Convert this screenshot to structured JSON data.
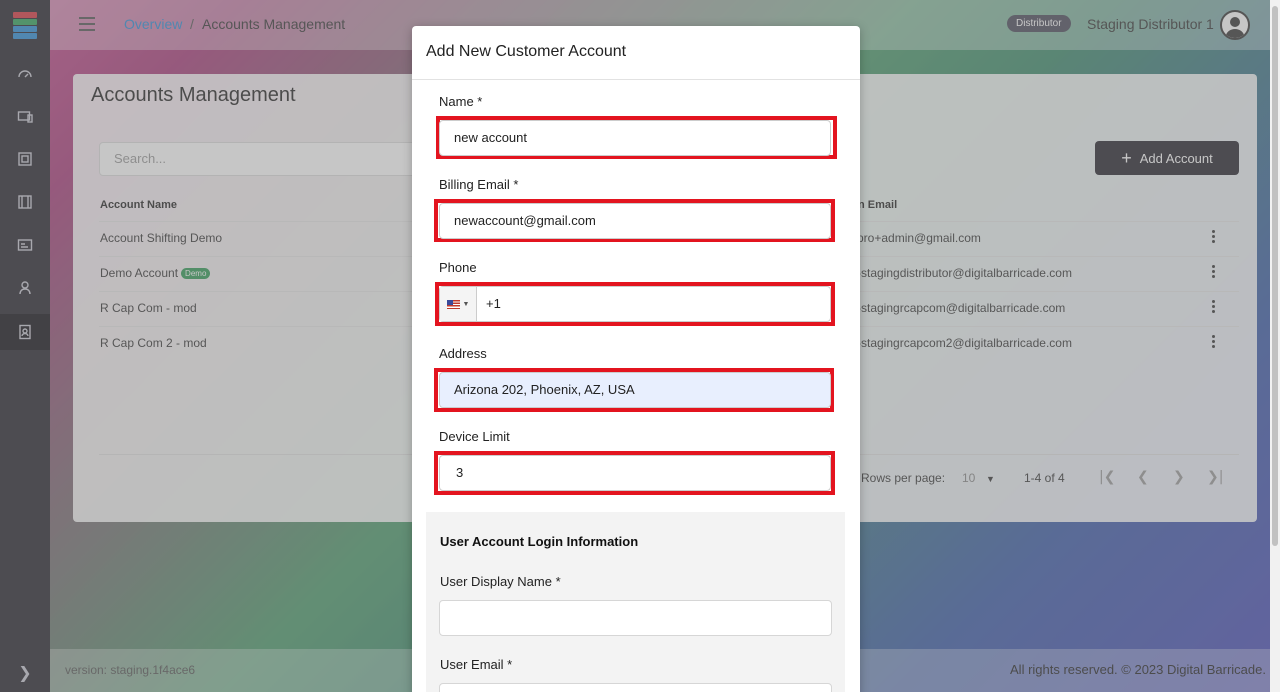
{
  "breadcrumb": {
    "link": "Overview",
    "separator": "/",
    "current": "Accounts Management"
  },
  "user": {
    "role_badge": "Distributor",
    "name": "Staging Distributor 1"
  },
  "page": {
    "title": "Accounts Management",
    "search_placeholder": "Search...",
    "add_button": "Add Account"
  },
  "table": {
    "headers": {
      "name": "Account Name",
      "email": "n Email"
    },
    "rows": [
      {
        "name": "Account Shifting Demo",
        "tag": "",
        "email": "pro+admin@gmail.com"
      },
      {
        "name": "Demo Account",
        "tag": "Demo",
        "email": "-stagingdistributor@digitalbarricade.com"
      },
      {
        "name": "R Cap Com - mod",
        "tag": "",
        "email": "-stagingrcapcom@digitalbarricade.com"
      },
      {
        "name": "R Cap Com 2 - mod",
        "tag": "",
        "email": "-stagingrcapcom2@digitalbarricade.com"
      }
    ]
  },
  "pagination": {
    "rows_label": "Rows per page:",
    "rows_value": "10",
    "range": "1-4 of 4"
  },
  "footer": {
    "version": "version: staging.1f4ace6",
    "rights": "All rights reserved. © 2023 Digital Barricade."
  },
  "modal": {
    "title": "Add New Customer Account",
    "fields": {
      "name_label": "Name *",
      "name_value": "new account",
      "email_label": "Billing Email *",
      "email_value": "newaccount@gmail.com",
      "phone_label": "Phone",
      "phone_value": "+1",
      "address_label": "Address",
      "address_value": "Arizona 202, Phoenix, AZ, USA",
      "limit_label": "Device Limit",
      "limit_value": "3"
    },
    "login_section": {
      "title": "User Account Login Information",
      "display_name_label": "User Display Name *",
      "user_email_label": "User Email *"
    }
  },
  "colors": {
    "highlight": "#e3141f",
    "sidebar": "#24212b",
    "primary_button": "#24222b",
    "demo_tag": "#2e9a54",
    "link": "#2b8dd8"
  }
}
